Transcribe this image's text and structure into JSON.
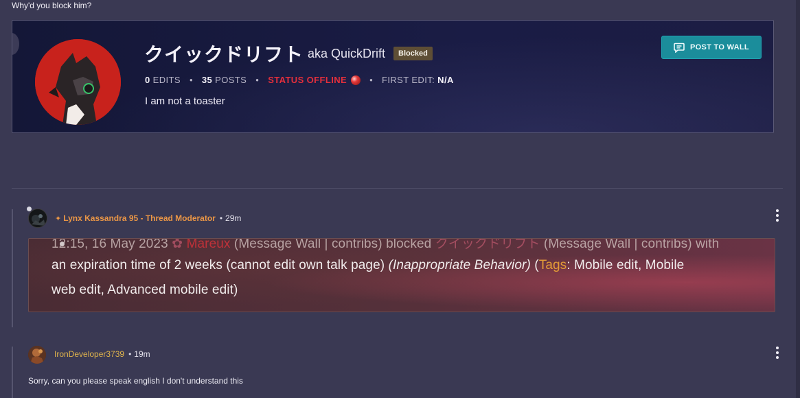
{
  "thread": {
    "reply_text": "Why'd you block him?"
  },
  "profile": {
    "username": "クイックドリフト",
    "aka_label": "aka QuickDrift",
    "blocked_badge": "Blocked",
    "stats": {
      "edits_count": "0",
      "edits_label": "EDITS",
      "posts_count": "35",
      "posts_label": "POSTS",
      "status": "STATUS OFFLINE",
      "first_edit_label": "FIRST EDIT:",
      "first_edit_value": "N/A"
    },
    "bio": "I am not a toaster",
    "post_to_wall_label": "POST TO WALL"
  },
  "posts": [
    {
      "author": "Lynx Kassandra 95 - Thread Moderator",
      "time": "29m",
      "embed": {
        "line1_prefix": "12:15, 16 May 2023",
        "line1_user": "Mareux",
        "line1_links": "(Message Wall | contribs)",
        "line1_action": "blocked",
        "line1_target": "クイックドリフト",
        "line1_target_links": "(Message Wall | contribs)",
        "line1_suffix": "with",
        "line2_text": "an expiration time of 2 weeks (cannot edit own talk page)",
        "line2_reason": "(Inappropriate Behavior)",
        "line2_paren": "(",
        "line2_tags_label": "Tags",
        "line2_tags": ": Mobile edit, Mobile",
        "line3_text": "web edit, Advanced mobile edit)"
      }
    },
    {
      "author": "IronDeveloper3739",
      "time": "19m",
      "body": "Sorry, can you please speak english I don't understand this"
    }
  ],
  "colors": {
    "background": "#3a3953",
    "card": "#1a1c45",
    "accent_teal": "#1b8d9b",
    "status_red": "#e42f3c",
    "moderator_orange": "#ea9646",
    "author_gold": "#e0b44c"
  }
}
